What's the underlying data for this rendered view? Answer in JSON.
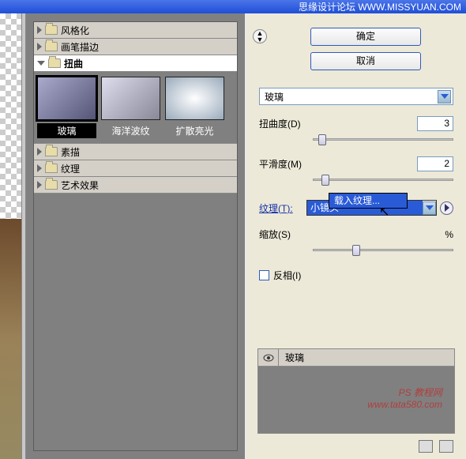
{
  "titlebar": {
    "text": "思缘设计论坛  WWW.MISSYUAN.COM"
  },
  "categories": {
    "items": [
      {
        "label": "风格化",
        "expanded": false,
        "selected": false
      },
      {
        "label": "画笔描边",
        "expanded": false,
        "selected": false
      },
      {
        "label": "扭曲",
        "expanded": true,
        "selected": true
      },
      {
        "label": "素描",
        "expanded": false,
        "selected": false
      },
      {
        "label": "纹理",
        "expanded": false,
        "selected": false
      },
      {
        "label": "艺术效果",
        "expanded": false,
        "selected": false
      }
    ]
  },
  "thumbs": [
    {
      "label": "玻璃",
      "selected": true
    },
    {
      "label": "海洋波纹",
      "selected": false
    },
    {
      "label": "扩散亮光",
      "selected": false
    }
  ],
  "buttons": {
    "ok": "确定",
    "cancel": "取消"
  },
  "filter_select": {
    "value": "玻璃"
  },
  "params": {
    "distortion": {
      "label": "扭曲度(D)",
      "value": "3",
      "pos_pct": 4
    },
    "smoothness": {
      "label": "平滑度(M)",
      "value": "2",
      "pos_pct": 6
    },
    "texture": {
      "label": "纹理(T):",
      "value": "小镜头"
    },
    "scale": {
      "label": "缩放(S)",
      "suffix": "%",
      "pos_pct": 28
    },
    "invert": {
      "label": "反相(I)"
    }
  },
  "flyout": {
    "label": "载入纹理..."
  },
  "layers": {
    "row_label": "玻璃"
  },
  "watermark": {
    "l1": "PS 教程网",
    "l2": "www.tata580.com"
  }
}
